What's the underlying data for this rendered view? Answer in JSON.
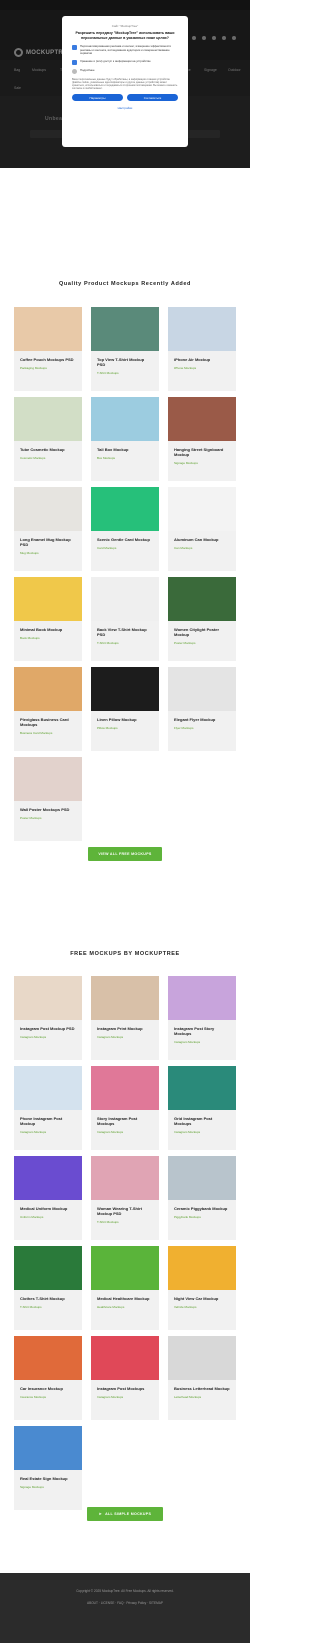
{
  "header": {
    "logo_text": "MOCKUPTREE"
  },
  "nav": {
    "items": [
      "Bag",
      "Mockups",
      "T-Shirt",
      "Print",
      "Packaging",
      "Apparel",
      "Branding",
      "Device",
      "Signage",
      "Outdoor",
      "Sale",
      "Spare",
      "Bottles"
    ]
  },
  "hero": {
    "title": "Unbeatable Free Mockup Packages"
  },
  "modal": {
    "source": "Сайт \"MockupTree\"",
    "question": "Разрешить передачу \"MockupTree\" использовать ваши персональные данные в указанных ниже целях?",
    "options": [
      "Персонализированная реклама и контент, измерение эффективности рекламы и контента, исследования аудитории и совершенствование сервисов",
      "Хранение и (или) доступ к информации на устройстве",
      "Подробнее"
    ],
    "fine_print": "Ваши персональные данные будут обработаны, а информация о вашем устройстве (файлы cookie, уникальные идентификаторы и другие данные устройства) может храниться, использоваться и передаваться сторонним поставщикам. Вы можете изменить согласие в любой момент.",
    "btn_manage": "Параметры",
    "btn_accept": "Согласиться",
    "link": "Настройки"
  },
  "recent": {
    "title": "Quality Product Mockups Recently Added",
    "items": [
      {
        "name": "Coffee Pouch Mockups PSD",
        "cat": "Packaging Mockups",
        "color": "#e8c9a8"
      },
      {
        "name": "Top View T-Shirt Mockup PSD",
        "cat": "T-Shirt Mockups",
        "color": "#5a8a7a"
      },
      {
        "name": "iPhone Air Mockup",
        "cat": "iPhone Mockups",
        "color": "#c8d6e4"
      },
      {
        "name": "Tube Cosmetic Mockup",
        "cat": "Cosmetic Mockups",
        "color": "#d2dec6"
      },
      {
        "name": "Tall Box Mockup",
        "cat": "Box Mockups",
        "color": "#9ccce0"
      },
      {
        "name": "Hanging Street Signboard Mockup",
        "cat": "Signage Mockups",
        "color": "#9a5a48"
      },
      {
        "name": "Long Enamel Mug Mockup PSD",
        "cat": "Mug Mockups",
        "color": "#e6e4e0"
      },
      {
        "name": "Scenic Gentle Card Mockup",
        "cat": "Card Mockups",
        "color": "#26c07a"
      },
      {
        "name": "Aluminum Can Mockup",
        "cat": "Can Mockups",
        "color": "#f3f3f3"
      },
      {
        "name": "Minimal Book Mockup",
        "cat": "Book Mockups",
        "color": "#f0c84a"
      },
      {
        "name": "Back View T-Shirt Mockup PSD",
        "cat": "T-Shirt Mockups",
        "color": "#efefef"
      },
      {
        "name": "Women Citylight Poster Mockup",
        "cat": "Poster Mockups",
        "color": "#3a6a3a"
      },
      {
        "name": "Plexiglass Business Card Mockups",
        "cat": "Business Card Mockups",
        "color": "#e0a868"
      },
      {
        "name": "Linen Pillow Mockup",
        "cat": "Pillow Mockups",
        "color": "#1c1c1c"
      },
      {
        "name": "Elegant Flyer Mockup",
        "cat": "Flyer Mockups",
        "color": "#e4e4e4"
      },
      {
        "name": "Wall Poster Mockups PSD",
        "cat": "Poster Mockups",
        "color": "#e2d2cc"
      }
    ],
    "button": "VIEW ALL FREE MOCKUPS"
  },
  "free": {
    "title": "FREE MOCKUPS BY MOCKUPTREE",
    "items": [
      {
        "name": "Instagram Post Mockup PSD",
        "cat": "Instagram Mockups",
        "color": "#e8d8c8"
      },
      {
        "name": "Instagram Print Mockup",
        "cat": "Instagram Mockups",
        "color": "#d8c0a8"
      },
      {
        "name": "Instagram Post Story Mockups",
        "cat": "Instagram Mockups",
        "color": "#c8a4dc"
      },
      {
        "name": "Phone Instagram Post Mockup",
        "cat": "Instagram Mockups",
        "color": "#d4e2ee"
      },
      {
        "name": "Story Instagram Post Mockups",
        "cat": "Instagram Mockups",
        "color": "#e07898"
      },
      {
        "name": "Grid Instagram Post Mockups",
        "cat": "Instagram Mockups",
        "color": "#2a8a7a"
      },
      {
        "name": "Medical Uniform Mockup",
        "cat": "Uniform Mockups",
        "color": "#6a4cd0"
      },
      {
        "name": "Woman Wearing T-Shirt Mockup PSD",
        "cat": "T-Shirt Mockups",
        "color": "#e0a4b4"
      },
      {
        "name": "Ceramic Piggybank Mockup",
        "cat": "Piggybank Mockups",
        "color": "#b8c4cc"
      },
      {
        "name": "Clothes T-Shirt Mockup",
        "cat": "T-Shirt Mockups",
        "color": "#2a7a3a"
      },
      {
        "name": "Medical Healthcare Mockup",
        "cat": "Healthcare Mockups",
        "color": "#5ab43a"
      },
      {
        "name": "Night View Car Mockup",
        "cat": "Vehicle Mockups",
        "color": "#f0b030"
      },
      {
        "name": "Car Insurance Mockup",
        "cat": "Insurance Mockups",
        "color": "#e06a3a"
      },
      {
        "name": "Instagram Post Mockups",
        "cat": "Instagram Mockups",
        "color": "#e04858"
      },
      {
        "name": "Business Letterhead Mockup",
        "cat": "Letterhead Mockups",
        "color": "#d8d8d8"
      },
      {
        "name": "Real Estate Sign Mockup",
        "cat": "Signage Mockups",
        "color": "#4a8ad0"
      }
    ],
    "button": "ALL SIMPLE MOCKUPS"
  },
  "footer": {
    "line1": "Copyright © 2025 MockupTree. All Free Mockups. All rights reserved.",
    "line2": "ABOUT · LICENSE · FAQ · Privacy Policy · SITEMAP"
  }
}
